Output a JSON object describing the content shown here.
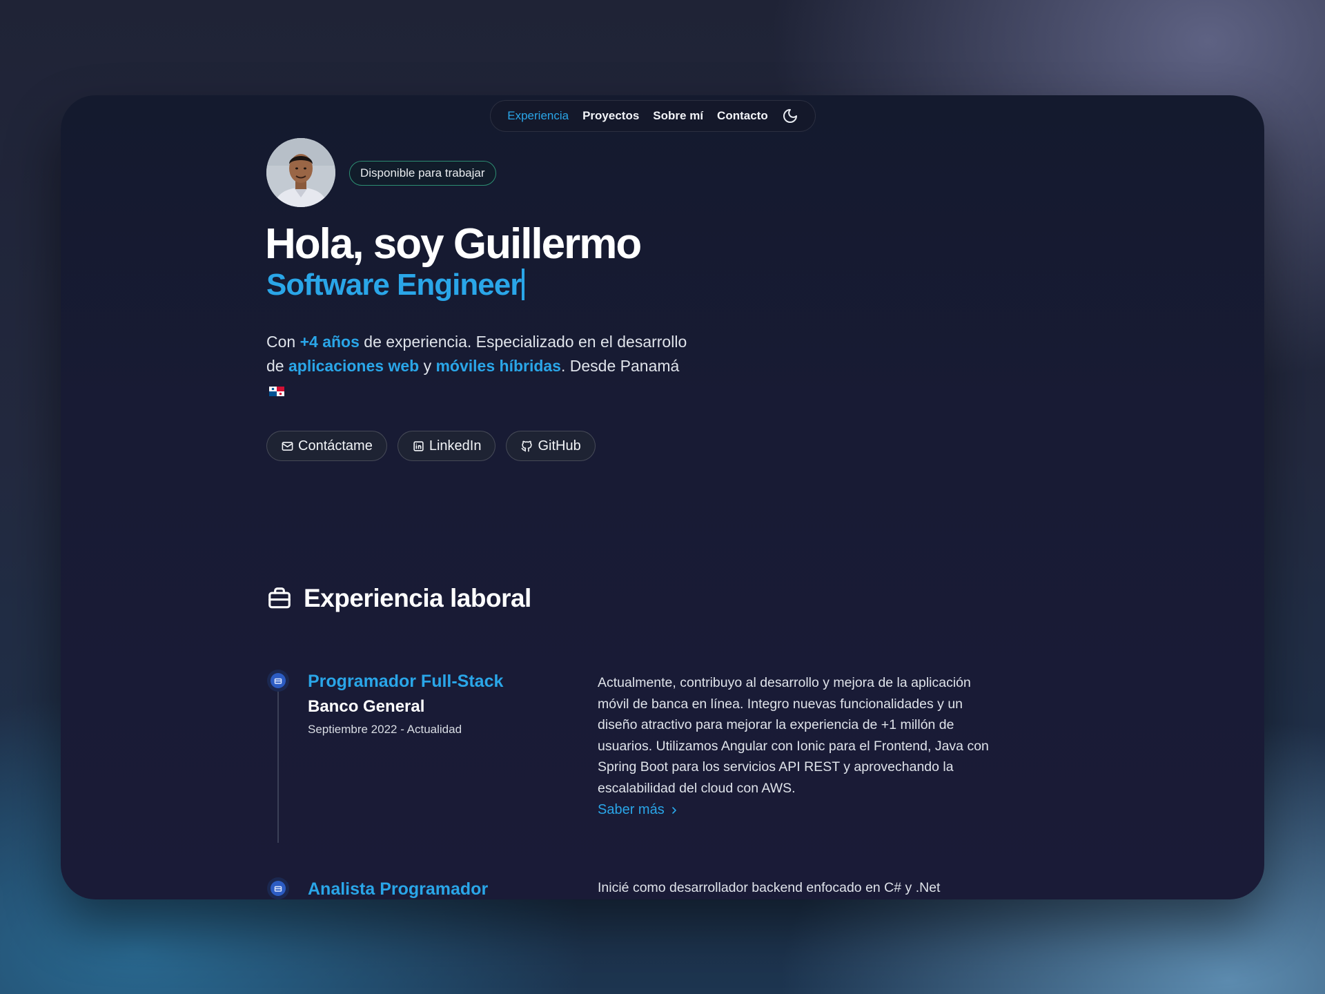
{
  "nav": {
    "items": [
      "Experiencia",
      "Proyectos",
      "Sobre mí",
      "Contacto"
    ],
    "active": "Experiencia",
    "theme_icon": "moon-icon"
  },
  "hero": {
    "status_badge": "Disponible para trabajar",
    "greeting": "Hola, soy Guillermo",
    "role": "Software Engineer",
    "intro": {
      "t1": "Con ",
      "years": "+4 años",
      "t2": " de experiencia. Especializado en el desarrollo de ",
      "web": "aplicaciones web",
      "t3": " y ",
      "mobile": "móviles híbridas",
      "t4": ". Desde Panamá"
    },
    "buttons": [
      {
        "label": "Contáctame",
        "icon": "mail-icon"
      },
      {
        "label": "LinkedIn",
        "icon": "linkedin-icon"
      },
      {
        "label": "GitHub",
        "icon": "github-icon"
      }
    ]
  },
  "experience": {
    "title": "Experiencia laboral",
    "icon": "briefcase-icon",
    "jobs": [
      {
        "title": "Programador Full-Stack",
        "company": "Banco General",
        "dates": "Septiembre 2022 - Actualidad",
        "description": "Actualmente, contribuyo al desarrollo y mejora de la aplicación móvil de banca en línea. Integro nuevas funcionalidades y un diseño atractivo para mejorar la experiencia de +1 millón de usuarios. Utilizamos Angular con Ionic para el Frontend, Java con Spring Boot para los servicios API REST y aprovechando la escalabilidad del cloud con AWS.",
        "link": "Saber más"
      },
      {
        "title": "Analista Programador",
        "description": "Inicié como desarrollador backend enfocado en C# y .Net"
      }
    ]
  },
  "colors": {
    "accent": "#2aa6e8",
    "badge_border": "#2d8f73",
    "window_bg": "#181b34"
  }
}
